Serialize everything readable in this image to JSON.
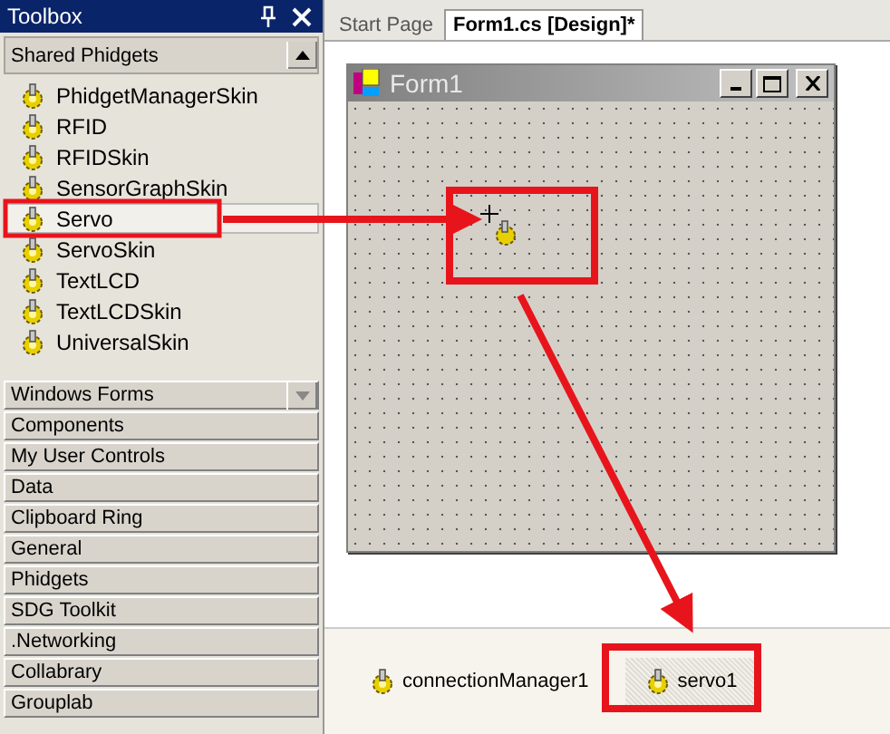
{
  "toolbox": {
    "title": "Toolbox",
    "active_section": {
      "label": "Shared Phidgets",
      "items": [
        {
          "label": "PhidgetManagerSkin",
          "selected": false
        },
        {
          "label": "RFID",
          "selected": false
        },
        {
          "label": "RFIDSkin",
          "selected": false
        },
        {
          "label": "SensorGraphSkin",
          "selected": false
        },
        {
          "label": "Servo",
          "selected": true
        },
        {
          "label": "ServoSkin",
          "selected": false
        },
        {
          "label": "TextLCD",
          "selected": false
        },
        {
          "label": "TextLCDSkin",
          "selected": false
        },
        {
          "label": "UniversalSkin",
          "selected": false
        }
      ]
    },
    "categories": [
      {
        "label": "Windows Forms",
        "kind": "dropdown"
      },
      {
        "label": "Components",
        "kind": "plain"
      },
      {
        "label": "My User Controls",
        "kind": "plain"
      },
      {
        "label": "Data",
        "kind": "plain"
      },
      {
        "label": "Clipboard Ring",
        "kind": "plain"
      },
      {
        "label": "General",
        "kind": "plain"
      },
      {
        "label": "Phidgets",
        "kind": "plain"
      },
      {
        "label": "SDG Toolkit",
        "kind": "plain"
      },
      {
        "label": ".Networking",
        "kind": "plain"
      },
      {
        "label": "Collabrary",
        "kind": "plain"
      },
      {
        "label": "Grouplab",
        "kind": "plain"
      }
    ]
  },
  "tabs": [
    {
      "label": "Start Page",
      "selected": false
    },
    {
      "label": "Form1.cs [Design]*",
      "selected": true
    }
  ],
  "form": {
    "title": "Form1"
  },
  "component_tray": [
    {
      "label": "connectionManager1",
      "selected": false
    },
    {
      "label": "servo1",
      "selected": true
    }
  ]
}
